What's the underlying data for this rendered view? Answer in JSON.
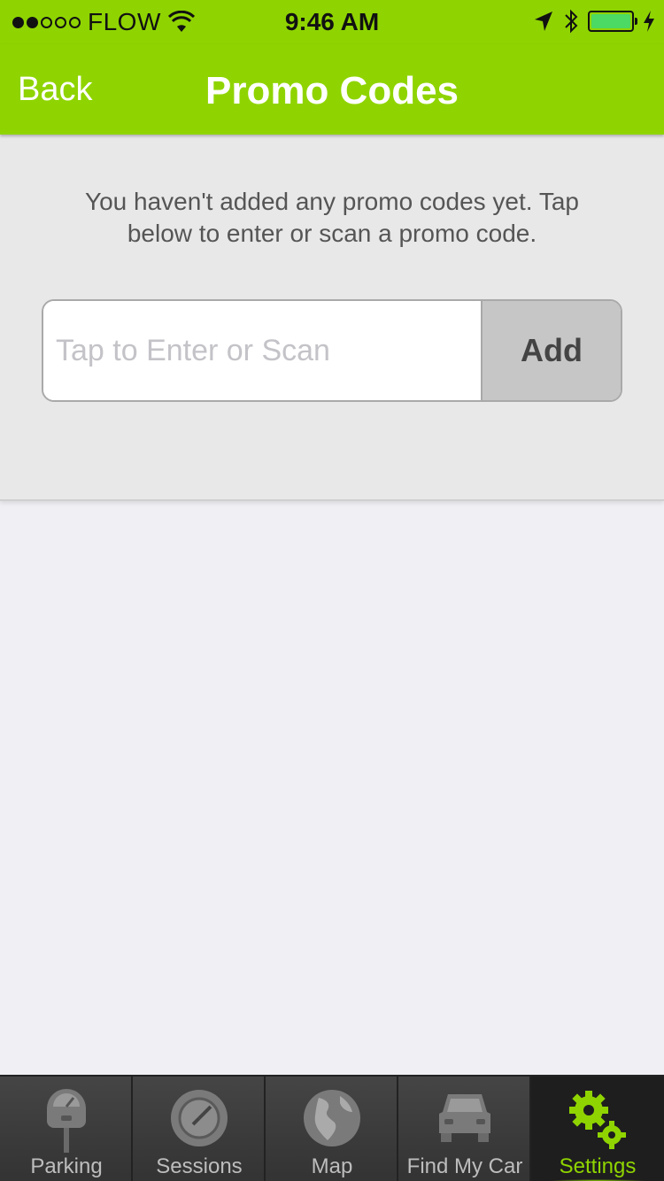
{
  "status_bar": {
    "carrier": "FLOW",
    "time": "9:46 AM"
  },
  "nav": {
    "back_label": "Back",
    "title": "Promo Codes"
  },
  "content": {
    "message": "You haven't added any promo codes yet. Tap below to enter or scan a promo code.",
    "input_placeholder": "Tap to Enter or Scan",
    "input_value": "",
    "add_label": "Add"
  },
  "tabs": [
    {
      "label": "Parking",
      "icon": "parking-meter-icon",
      "active": false
    },
    {
      "label": "Sessions",
      "icon": "clock-icon",
      "active": false
    },
    {
      "label": "Map",
      "icon": "globe-icon",
      "active": false
    },
    {
      "label": "Find My Car",
      "icon": "car-icon",
      "active": false
    },
    {
      "label": "Settings",
      "icon": "gears-icon",
      "active": true
    }
  ],
  "colors": {
    "accent": "#8fd400",
    "tabbar": "#3a3a3a",
    "panel": "#e8e8e8"
  }
}
